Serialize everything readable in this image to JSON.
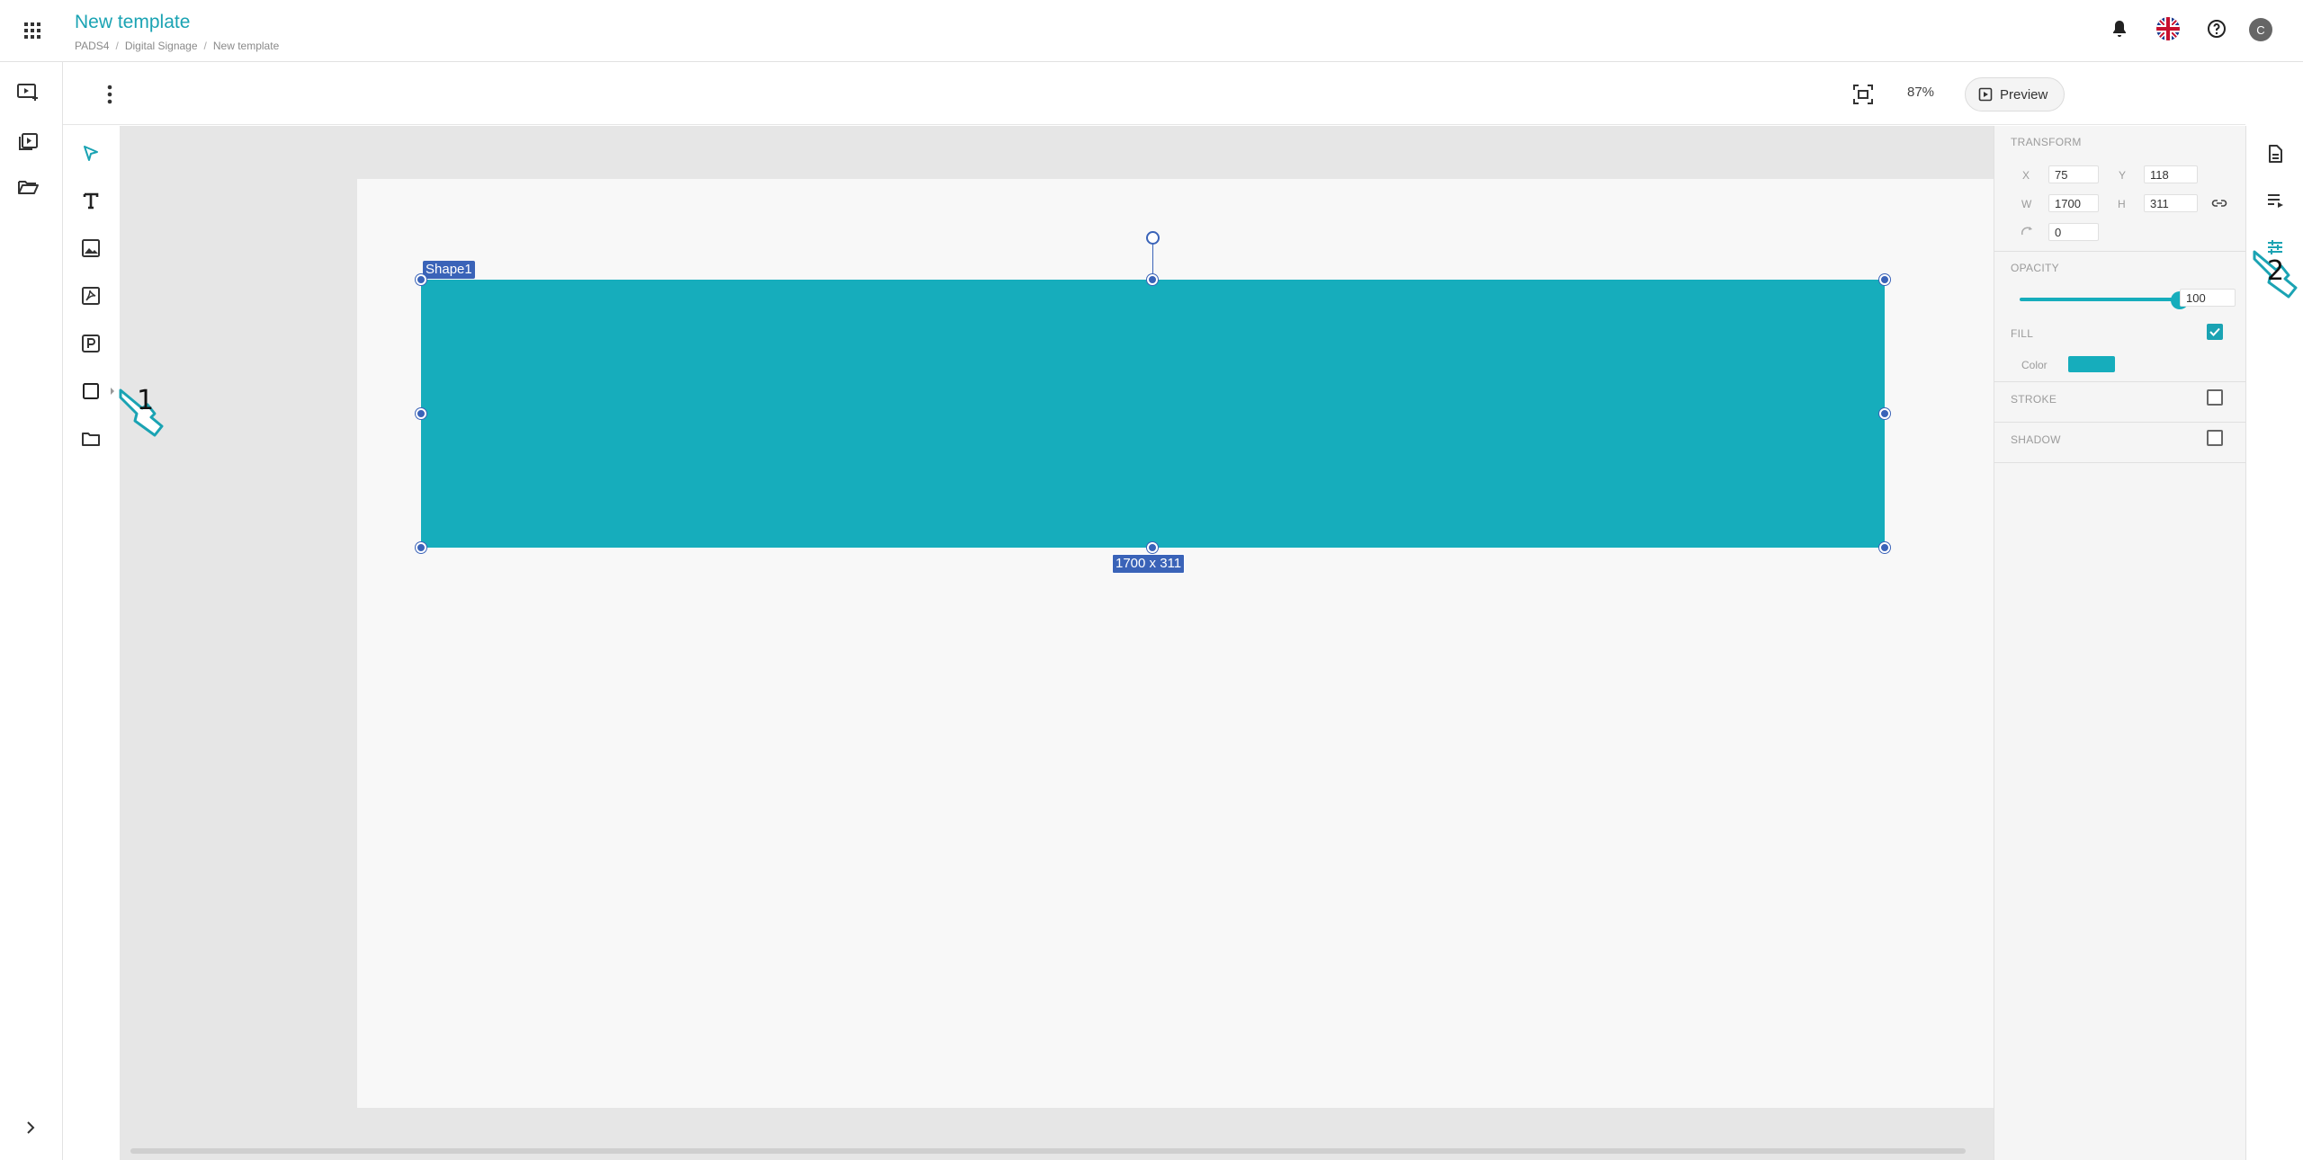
{
  "header": {
    "title": "New template",
    "breadcrumb": [
      "PADS4",
      "Digital Signage",
      "New template"
    ],
    "breadcrumb_sep": "/",
    "avatar_initial": "C",
    "icons": [
      "apps-grid-icon",
      "bell-icon",
      "uk-flag-icon",
      "help-icon"
    ]
  },
  "toolbar": {
    "zoom": "87%",
    "preview_label": "Preview"
  },
  "canvas": {
    "shape_name": "Shape1",
    "size_label": "1700 x 311",
    "shape_color": "#16adbc"
  },
  "callouts": {
    "one": "1",
    "two": "2"
  },
  "properties": {
    "transform": {
      "title": "TRANSFORM",
      "x_label": "X",
      "x": "75",
      "y_label": "Y",
      "y": "118",
      "w_label": "W",
      "w": "1700",
      "h_label": "H",
      "h": "311",
      "rotation": "0"
    },
    "opacity": {
      "title": "OPACITY",
      "value": "100",
      "level_percent": 100
    },
    "fill": {
      "title": "FILL",
      "enabled": true,
      "color_label": "Color",
      "color": "#16adbc"
    },
    "stroke": {
      "title": "STROKE",
      "enabled": false
    },
    "shadow": {
      "title": "SHADOW",
      "enabled": false
    }
  },
  "colors": {
    "accent": "#1aa3b3",
    "selection": "#3a63b8",
    "canvas_bg": "#e6e6e6"
  }
}
